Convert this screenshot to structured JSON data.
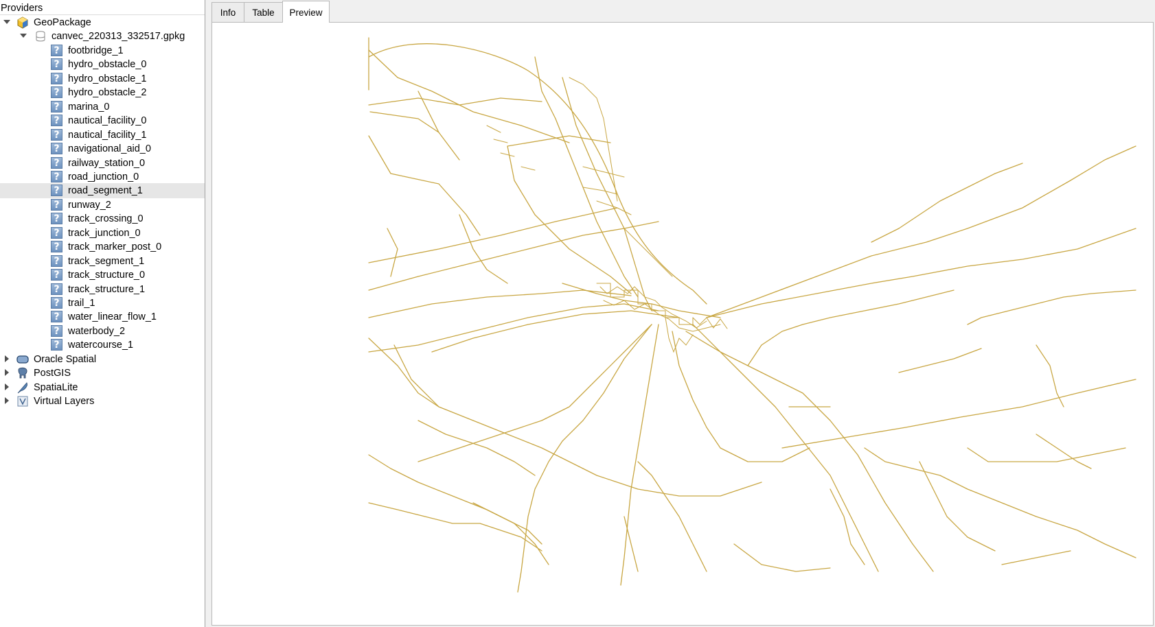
{
  "providers_panel": {
    "title": "Providers",
    "tree": [
      {
        "label": "GeoPackage",
        "level": 0,
        "expanded": true,
        "icon": "geopackage-icon"
      },
      {
        "label": "canvec_220313_332517.gpkg",
        "level": 1,
        "expanded": true,
        "icon": "database-icon"
      },
      {
        "label": "footbridge_1",
        "level": 2,
        "icon": "unknown-layer-icon"
      },
      {
        "label": "hydro_obstacle_0",
        "level": 2,
        "icon": "unknown-layer-icon"
      },
      {
        "label": "hydro_obstacle_1",
        "level": 2,
        "icon": "unknown-layer-icon"
      },
      {
        "label": "hydro_obstacle_2",
        "level": 2,
        "icon": "unknown-layer-icon"
      },
      {
        "label": "marina_0",
        "level": 2,
        "icon": "unknown-layer-icon"
      },
      {
        "label": "nautical_facility_0",
        "level": 2,
        "icon": "unknown-layer-icon"
      },
      {
        "label": "nautical_facility_1",
        "level": 2,
        "icon": "unknown-layer-icon"
      },
      {
        "label": "navigational_aid_0",
        "level": 2,
        "icon": "unknown-layer-icon"
      },
      {
        "label": "railway_station_0",
        "level": 2,
        "icon": "unknown-layer-icon"
      },
      {
        "label": "road_junction_0",
        "level": 2,
        "icon": "unknown-layer-icon"
      },
      {
        "label": "road_segment_1",
        "level": 2,
        "icon": "unknown-layer-icon",
        "selected": true
      },
      {
        "label": "runway_2",
        "level": 2,
        "icon": "unknown-layer-icon"
      },
      {
        "label": "track_crossing_0",
        "level": 2,
        "icon": "unknown-layer-icon"
      },
      {
        "label": "track_junction_0",
        "level": 2,
        "icon": "unknown-layer-icon"
      },
      {
        "label": "track_marker_post_0",
        "level": 2,
        "icon": "unknown-layer-icon"
      },
      {
        "label": "track_segment_1",
        "level": 2,
        "icon": "unknown-layer-icon"
      },
      {
        "label": "track_structure_0",
        "level": 2,
        "icon": "unknown-layer-icon"
      },
      {
        "label": "track_structure_1",
        "level": 2,
        "icon": "unknown-layer-icon"
      },
      {
        "label": "trail_1",
        "level": 2,
        "icon": "unknown-layer-icon"
      },
      {
        "label": "water_linear_flow_1",
        "level": 2,
        "icon": "unknown-layer-icon"
      },
      {
        "label": "waterbody_2",
        "level": 2,
        "icon": "unknown-layer-icon"
      },
      {
        "label": "watercourse_1",
        "level": 2,
        "icon": "unknown-layer-icon"
      },
      {
        "label": "Oracle Spatial",
        "level": 0,
        "expanded": false,
        "icon": "oracle-icon"
      },
      {
        "label": "PostGIS",
        "level": 0,
        "expanded": false,
        "icon": "postgis-elephant-icon"
      },
      {
        "label": "SpatiaLite",
        "level": 0,
        "expanded": false,
        "icon": "spatialite-feather-icon"
      },
      {
        "label": "Virtual Layers",
        "level": 0,
        "expanded": false,
        "icon": "virtual-layer-icon"
      }
    ]
  },
  "tabs": [
    {
      "label": "Info",
      "active": false
    },
    {
      "label": "Table",
      "active": false
    },
    {
      "label": "Preview",
      "active": true
    }
  ],
  "preview": {
    "line_color": "#c8a642",
    "background": "#ffffff"
  }
}
